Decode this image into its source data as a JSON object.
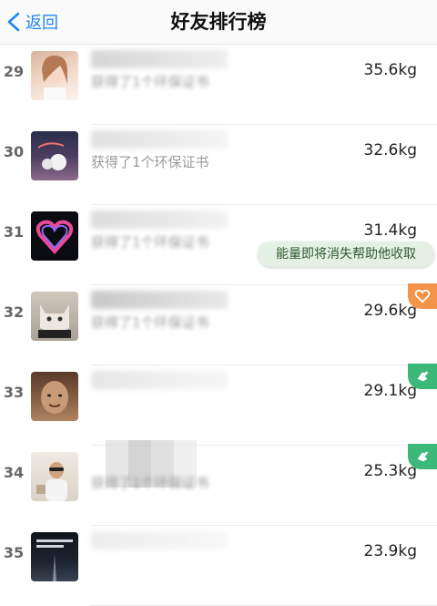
{
  "nav": {
    "back_label": "返回",
    "title": "好友排行榜"
  },
  "rows": [
    {
      "rank": "29",
      "subtitle": "获得了1个环保证书",
      "weight": "35.6kg",
      "badge": ""
    },
    {
      "rank": "30",
      "subtitle": "获得了1个环保证书",
      "weight": "32.6kg",
      "badge": ""
    },
    {
      "rank": "31",
      "subtitle": "获得了1个环保证书",
      "weight": "31.4kg",
      "badge": ""
    },
    {
      "rank": "32",
      "subtitle": "获得了1个环保证书",
      "weight": "29.6kg",
      "badge": "heart"
    },
    {
      "rank": "33",
      "subtitle": "",
      "weight": "29.1kg",
      "badge": "hand"
    },
    {
      "rank": "34",
      "subtitle": "获得了1个环保证书",
      "weight": "25.3kg",
      "badge": "hand"
    },
    {
      "rank": "35",
      "subtitle": "",
      "weight": "23.9kg",
      "badge": ""
    }
  ],
  "tooltip": {
    "text": "能量即将消失帮助他收取"
  },
  "colors": {
    "accent": "#1f86f0",
    "heart_badge": "#f4934a",
    "hand_badge": "#3cb878",
    "tooltip_bg": "#e4f0e4"
  },
  "icons": {
    "back": "chevron-left-icon",
    "heart_badge": "heart-icon",
    "hand_badge": "hand-icon"
  }
}
